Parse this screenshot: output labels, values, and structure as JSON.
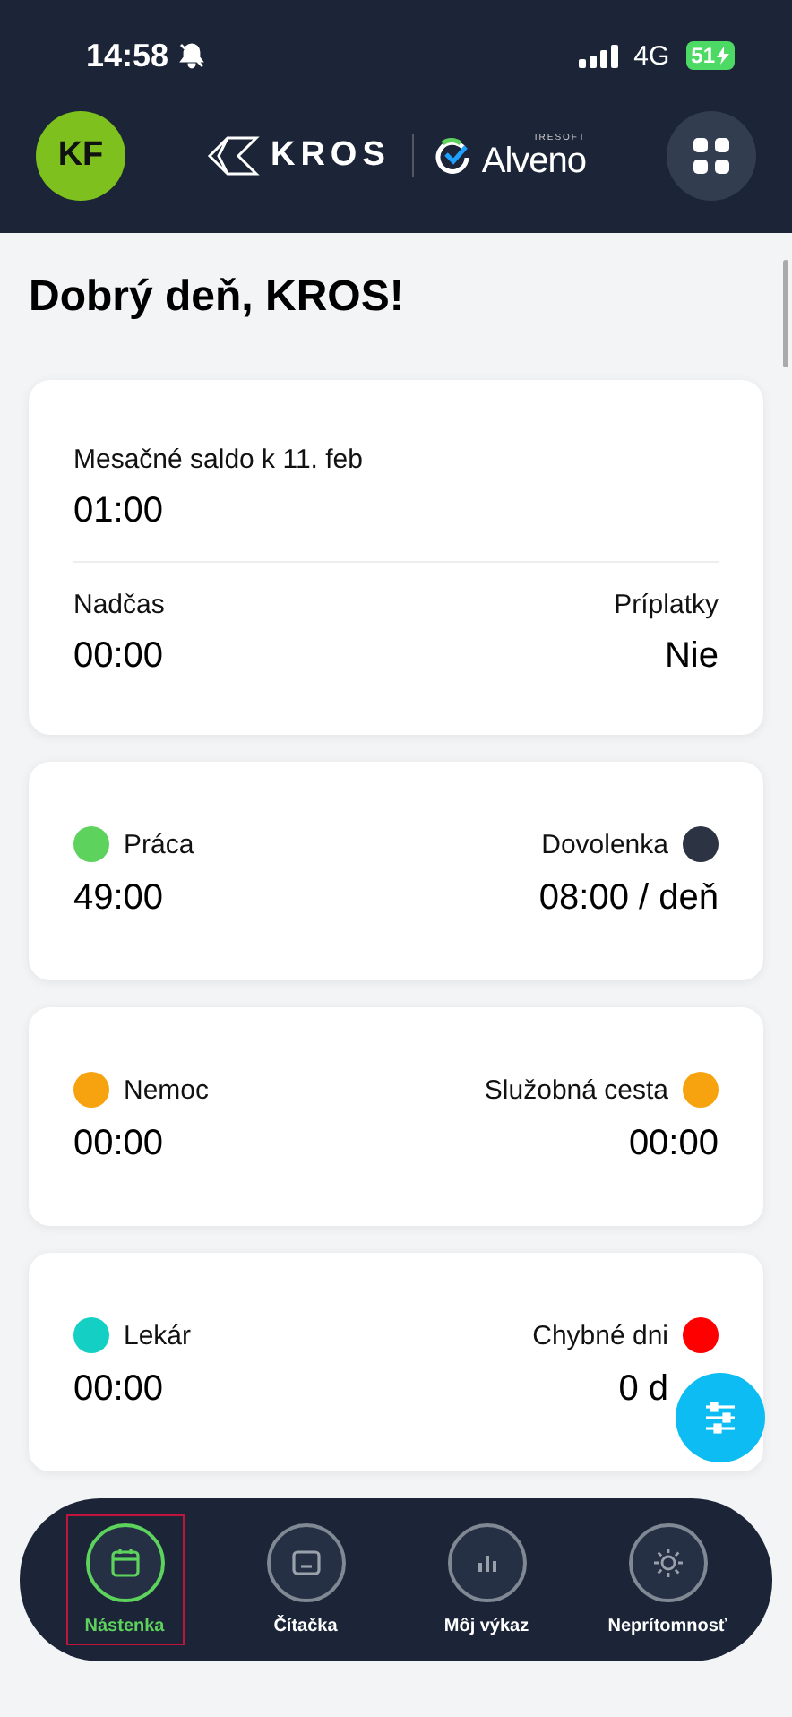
{
  "status_bar": {
    "time": "14:58",
    "network": "4G",
    "battery": "51"
  },
  "header": {
    "avatar": "KF",
    "logo_kros": "KROS",
    "logo_alveno": "Alveno",
    "logo_alveno_sub": "IRESOFT"
  },
  "greeting": "Dobrý deň, KROS!",
  "balance_card": {
    "label": "Mesačné saldo k 11. feb",
    "value": "01:00",
    "left": {
      "label": "Nadčas",
      "value": "00:00"
    },
    "right": {
      "label": "Príplatky",
      "value": "Nie"
    }
  },
  "stat_cards": [
    {
      "left": {
        "label": "Práca",
        "value": "49:00",
        "color": "#5dd35d"
      },
      "right": {
        "label": "Dovolenka",
        "value": "08:00 / deň",
        "color": "#2c3444"
      }
    },
    {
      "left": {
        "label": "Nemoc",
        "value": "00:00",
        "color": "#f7a30f"
      },
      "right": {
        "label": "Služobná cesta",
        "value": "00:00",
        "color": "#f7a30f"
      }
    },
    {
      "left": {
        "label": "Lekár",
        "value": "00:00",
        "color": "#14d0c4"
      },
      "right": {
        "label": "Chybné dni",
        "value": "0 d",
        "color": "#ff0000"
      }
    }
  ],
  "nav": [
    {
      "label": "Nástenka",
      "kind": "calendar",
      "selected": true
    },
    {
      "label": "Čítačka",
      "kind": "reader",
      "selected": false
    },
    {
      "label": "Môj výkaz",
      "kind": "chart",
      "selected": false
    },
    {
      "label": "Neprítomnosť",
      "kind": "sun",
      "selected": false
    }
  ]
}
